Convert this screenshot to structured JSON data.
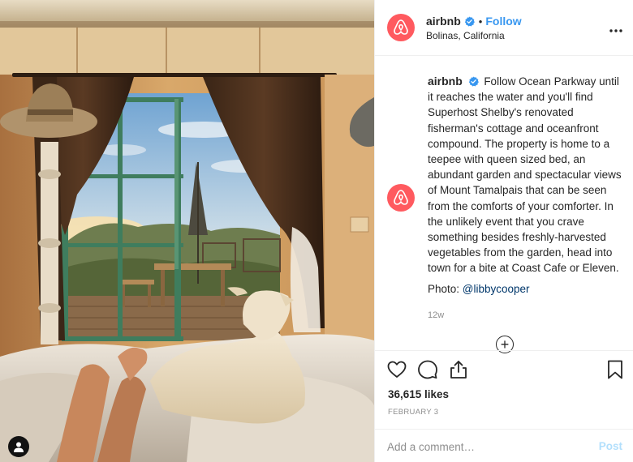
{
  "post": {
    "username": "airbnb",
    "follow_label": "Follow",
    "dot": "•",
    "location": "Bolinas, California",
    "more_label": "•••",
    "caption_text": "Follow Ocean Parkway until it reaches the water and you'll find Superhost Shelby's renovated fisherman's cottage and oceanfront compound. The property is home to a teepee with queen sized bed, an abundant garden and spectacular views of Mount Tamalpais that can be seen from the comforts of your comforter. In the unlikely event that you crave something besides freshly-harvested vegetables from the garden, head into town for a bite at Coast Cafe or Eleven.",
    "photo_credit_prefix": "Photo: ",
    "photo_credit_mention": "@libbycooper",
    "time_ago": "12w",
    "load_more_label": "+",
    "likes": "36,615 likes",
    "date": "FEBRUARY 3"
  },
  "comment": {
    "placeholder": "Add a comment…",
    "post_label": "Post"
  },
  "colors": {
    "brand": "#ff5a5f",
    "link": "#3897f0",
    "post_disabled": "#b2dffc"
  },
  "icons": {
    "verified": "verified-badge-icon",
    "like": "heart-icon",
    "comment": "comment-bubble-icon",
    "share": "share-icon",
    "save": "bookmark-icon",
    "user_tag": "user-tag-icon",
    "brand_logo": "airbnb-logo-icon"
  }
}
